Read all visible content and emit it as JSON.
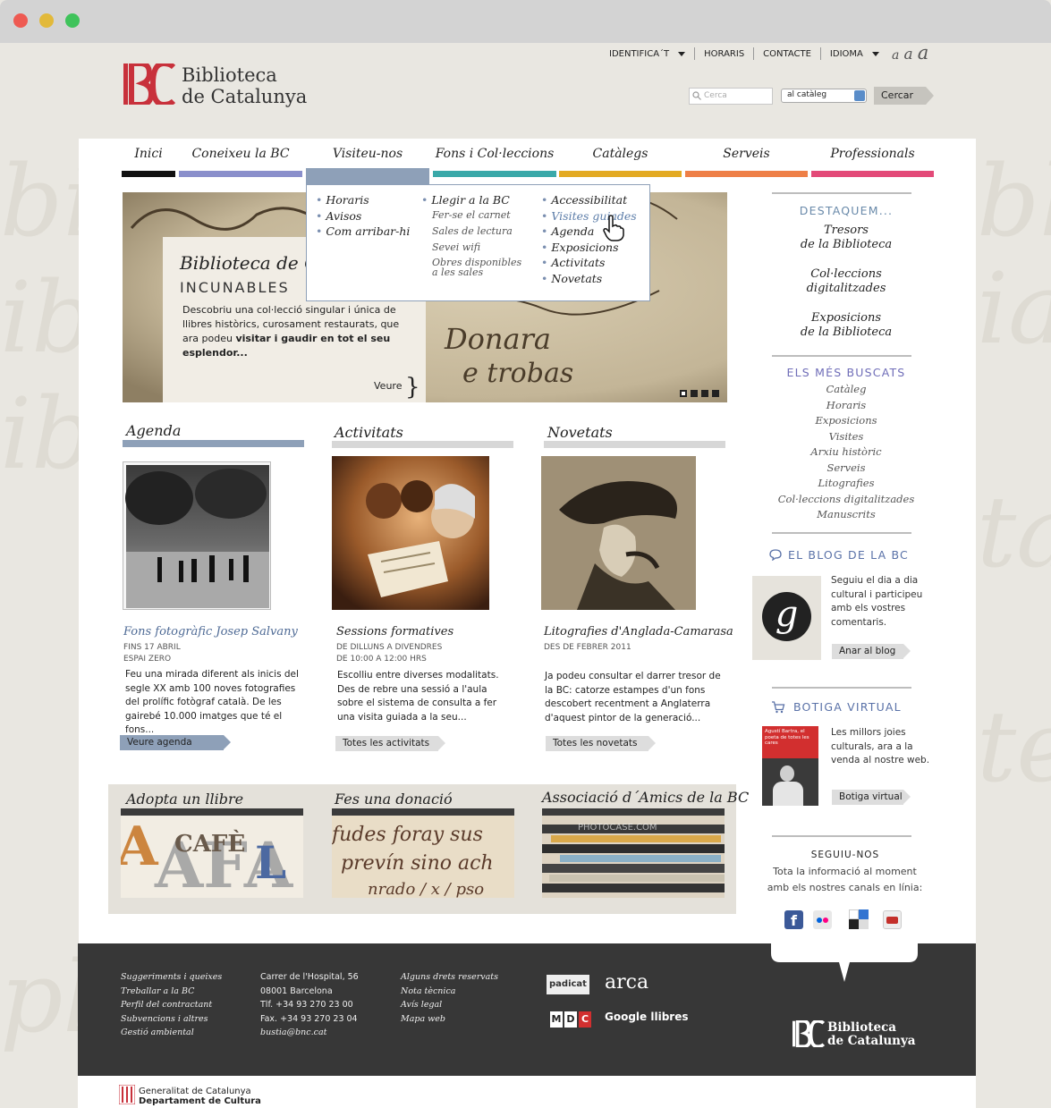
{
  "util_nav": {
    "items": [
      "IDENTIFICA´T",
      "HORARIS",
      "CONTACTE",
      "IDIOMA"
    ],
    "font_sizes": "a a a"
  },
  "logo": {
    "line1": "Biblioteca",
    "line2": "de Catalunya",
    "mark": "BC"
  },
  "search": {
    "placeholder": "Cerca",
    "scope": "al catàleg",
    "button": "Cercar"
  },
  "main_nav": [
    {
      "label": "Inici",
      "color": "#111111"
    },
    {
      "label": "Coneixeu la BC",
      "color": "#8a8fcb"
    },
    {
      "label": "Visiteu-nos",
      "color": "#8ea0b8"
    },
    {
      "label": "Fons i Col·leccions",
      "color": "#3aa9a9"
    },
    {
      "label": "Catàlegs",
      "color": "#e3aa22"
    },
    {
      "label": "Serveis",
      "color": "#ee7f47"
    },
    {
      "label": "Professionals",
      "color": "#e34a78"
    }
  ],
  "dropdown": {
    "col1": [
      "Horaris",
      "Avisos",
      "Com arribar-hi"
    ],
    "col2_main": "Llegir a la BC",
    "col2_sub": [
      "Fer-se el carnet",
      "Sales de lectura",
      "Sevei wifi",
      "Obres disponibles",
      "a les sales"
    ],
    "col3": [
      "Accessibilitat",
      "Visites guiades",
      "Agenda",
      "Exposicions",
      "Activitats",
      "Novetats"
    ]
  },
  "hero": {
    "title": "Biblioteca de Catalunya",
    "subtitle": "INCUNABLES",
    "desc_plain": "Descobriu una col·lecció singular i única de llibres històrics, curosament restaurats, que ara podeu ",
    "desc_bold": "visitar i gaudir en tot el seu esplendor...",
    "more": "Veure",
    "script1": "Donara",
    "script2": "e trobas"
  },
  "sections": {
    "agenda": {
      "title": "Agenda",
      "item_title": "Fons fotogràfic Josep Salvany",
      "meta1": "FINS 17 ABRIL",
      "meta2": "ESPAI ZERO",
      "text": "Feu una mirada diferent als inicis del segle XX amb 100 noves fotografies del prolífic fotògraf català. De les gairebé 10.000 imatges que té el fons...",
      "button": "Veure agenda"
    },
    "activitats": {
      "title": "Activitats",
      "item_title": "Sessions formatives",
      "meta1": "DE DILLUNS A DIVENDRES",
      "meta2": "DE 10:00 A 12:00 HRS",
      "text": "Escolliu entre diverses modalitats. Des de rebre una sessió a l'aula sobre el sistema de consulta a fer una visita guiada a la seu...",
      "button": "Totes les activitats"
    },
    "novetats": {
      "title": "Novetats",
      "item_title": "Litografies d'Anglada-Camarasa",
      "meta1": "DES DE FEBRER 2011",
      "text": "Ja podeu consultar el darrer tresor de la BC: catorze estampes d'un fons descobert recentment a Anglaterra d'aquest pintor de la generació...",
      "button": "Totes les novetats"
    }
  },
  "boxes": {
    "adopta": "Adopta un llibre",
    "donacio": "Fes una donació",
    "amics": "Associació d´Amics de la BC",
    "adopta_img": "CAFÈ",
    "donacio_img": "fudes foray sus",
    "amics_img": "PHOTOCASE.COM"
  },
  "sidebar": {
    "destaquem": "DESTAQUEM...",
    "featured": [
      [
        "Tresors",
        "de la Biblioteca"
      ],
      [
        "Col·leccions",
        "digitalitzades"
      ],
      [
        "Exposicions",
        "de la Biblioteca"
      ]
    ],
    "buscats_title": "ELS MÉS BUSCATS",
    "buscats": [
      "Catàleg",
      "Horaris",
      "Exposicions",
      "Visites",
      "Arxiu històric",
      "Serveis",
      "Litografies",
      "Col·leccions digitalitzades",
      "Manuscrits"
    ],
    "blog_title": "EL BLOG DE LA BC",
    "blog_logo": "g",
    "blog_text": "Seguiu el dia a dia cultural i participeu amb els vostres comentaris.",
    "blog_button": "Anar al blog",
    "shop_title": "BOTIGA VIRTUAL",
    "shop_book": "Agustí Bartra, el poeta de totes les cares",
    "shop_text": "Les millors joies culturals, ara a la venda al nostre web.",
    "shop_button": "Botiga virtual",
    "follow_title": "SEGUIU-NOS",
    "follow_text": "Tota la informació al moment amb els nostres canals en línia:",
    "social": [
      "facebook-icon",
      "flickr-icon",
      "delicious-icon",
      "youtube-icon"
    ]
  },
  "footer": {
    "col1": [
      "Suggeriments i queixes",
      "Treballar a la BC",
      "Perfil del contractant",
      "Subvencions i altres",
      "Gestió ambiental"
    ],
    "col2": [
      "Carrer de l'Hospital, 56",
      "08001 Barcelona",
      "Tlf. +34 93 270 23 00",
      "Fax. +34 93 270 23 04",
      "bustia@bnc.cat"
    ],
    "col3": [
      "Alguns drets reservats",
      "Nota tècnica",
      "Avís legal",
      "Mapa web"
    ],
    "partners": {
      "padicat": "padicat",
      "arca": "arca",
      "mdc": [
        "M",
        "D",
        "C"
      ],
      "google": "Google llibres"
    },
    "logo1": "Biblioteca",
    "logo2": "de Catalunya",
    "gov1": "Generalitat de Catalunya",
    "gov2": "Departament de Cultura"
  },
  "colors": {
    "accent_blue": "#4e5fa6",
    "agenda_blue": "#8ea0b8",
    "footer": "#373737"
  }
}
